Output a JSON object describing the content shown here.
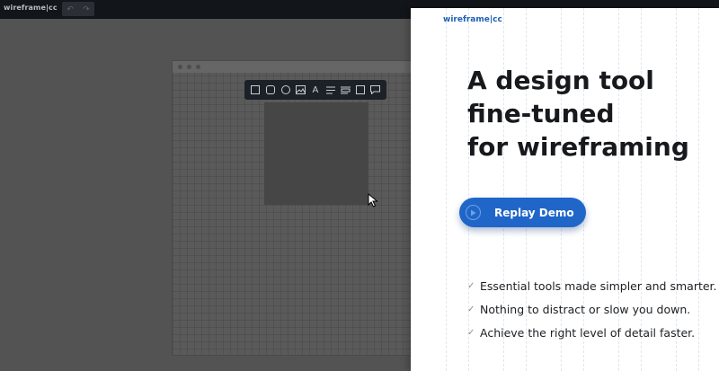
{
  "app": {
    "logo": "wireframe|cc",
    "undo_icon": "undo-icon",
    "redo_icon": "redo-icon"
  },
  "toolbar": {
    "tools": [
      "rectangle",
      "rounded-rectangle",
      "circle",
      "image",
      "text",
      "paragraph",
      "list",
      "box",
      "comment"
    ],
    "text_tool_label": "A"
  },
  "panel": {
    "brand": "wireframe|cc",
    "headline": [
      "A design tool",
      "fine-tuned",
      "for wireframing"
    ],
    "demo_button": "Replay Demo",
    "features": [
      "Essential tools made simpler and smarter.",
      "Nothing to distract or slow you down.",
      "Achieve the right level of detail faster."
    ],
    "check_glyph": "✓"
  },
  "colors": {
    "accent": "#1f66c8",
    "brand": "#1f5fb5",
    "topbar": "#121519",
    "toolbar": "#1c2128"
  }
}
